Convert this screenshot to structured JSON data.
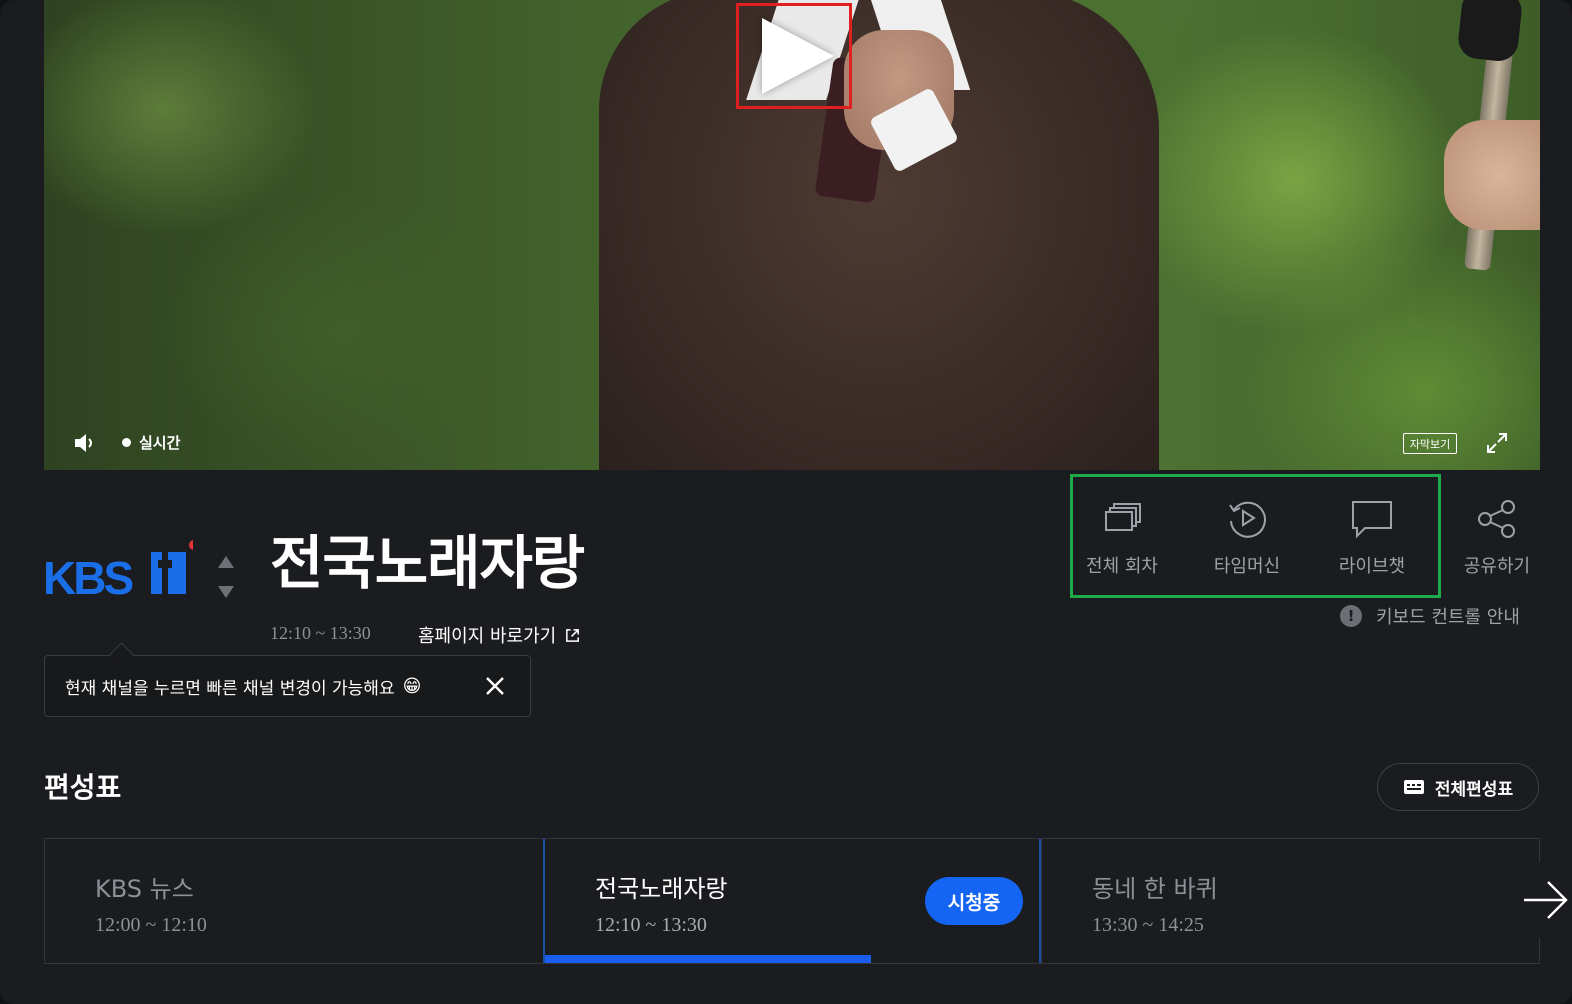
{
  "player": {
    "live_label": "실시간",
    "caption_label": "자막보기"
  },
  "channel": {
    "logo_text": "KBS",
    "logo_number": "1",
    "brand_color": "#1a6ee8",
    "dot_color": "#e8333a"
  },
  "program": {
    "title": "전국노래자랑",
    "time_range": "12:10 ~ 13:30",
    "homepage_link": "홈페이지 바로가기"
  },
  "tooltip": {
    "text": "현재 채널을 누르면 빠른 채널 변경이 가능해요",
    "emoji": "😁"
  },
  "actions": [
    {
      "label": "전체 회차",
      "icon": "episodes-icon"
    },
    {
      "label": "타임머신",
      "icon": "timemachine-icon"
    },
    {
      "label": "라이브챗",
      "icon": "chat-icon"
    },
    {
      "label": "공유하기",
      "icon": "share-icon"
    }
  ],
  "keyboard_guide": "키보드 컨트롤 안내",
  "schedule": {
    "heading": "편성표",
    "full_button": "전체편성표",
    "items": [
      {
        "title": "KBS 뉴스",
        "time": "12:00 ~ 12:10"
      },
      {
        "title": "전국노래자랑",
        "time": "12:10 ~ 13:30",
        "badge": "시청중",
        "progress": 0.66
      },
      {
        "title": "동네 한 바퀴",
        "time": "13:30 ~ 14:25"
      }
    ]
  },
  "colors": {
    "accent": "#1565f5",
    "highlight_red": "#e02020",
    "highlight_green": "#1ea94a"
  }
}
